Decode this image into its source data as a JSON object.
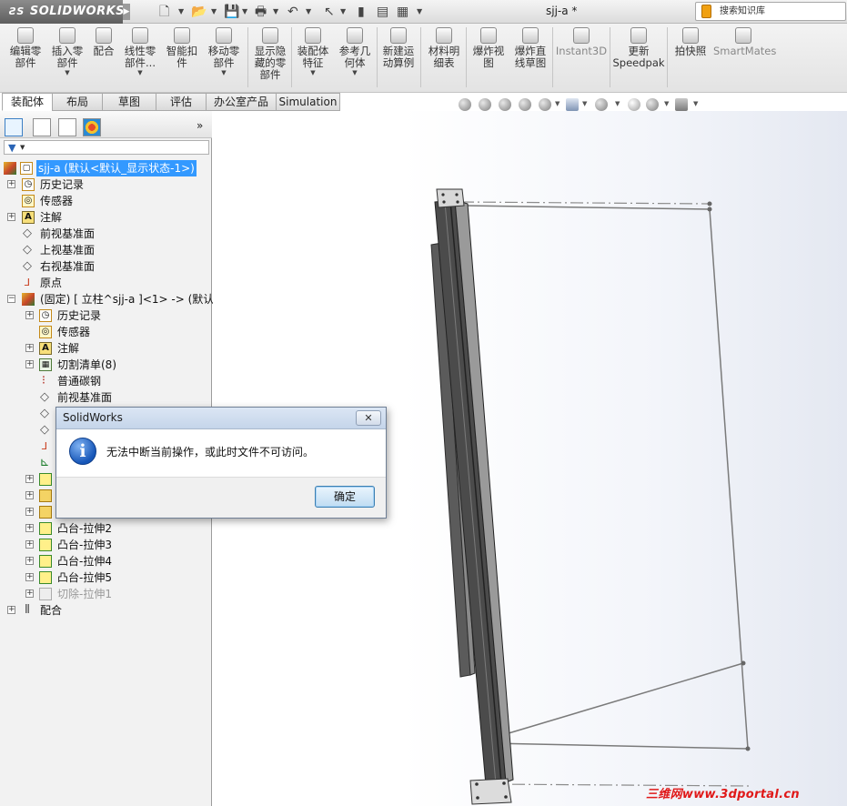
{
  "titlebar": {
    "logo": "SOLIDWORKS",
    "document_title": "sjj-a *",
    "search_placeholder": "搜索知识库"
  },
  "ribbon": {
    "items": [
      {
        "label": "编辑零\n部件"
      },
      {
        "label": "插入零\n部件"
      },
      {
        "label": "配合"
      },
      {
        "label": "线性零\n部件..."
      },
      {
        "label": "智能扣\n件"
      },
      {
        "label": "移动零\n部件"
      },
      {
        "label": "显示隐\n藏的零\n部件"
      },
      {
        "label": "装配体\n特征"
      },
      {
        "label": "参考几\n何体"
      },
      {
        "label": "新建运\n动算例"
      },
      {
        "label": "材料明\n细表"
      },
      {
        "label": "爆炸视\n图"
      },
      {
        "label": "爆炸直\n线草图"
      },
      {
        "label": "Instant3D"
      },
      {
        "label": "更新\nSpeedpak"
      },
      {
        "label": "拍快照"
      },
      {
        "label": "SmartMates"
      }
    ]
  },
  "tabs": [
    "装配体",
    "布局",
    "草图",
    "评估",
    "办公室产品",
    "Simulation"
  ],
  "active_tab": "装配体",
  "tree": {
    "rows": [
      {
        "label": "sjj-a  (默认<默认_显示状态-1>)",
        "selected": true
      },
      {
        "label": "历史记录"
      },
      {
        "label": "传感器"
      },
      {
        "label": "注解"
      },
      {
        "label": "前视基准面"
      },
      {
        "label": "上视基准面"
      },
      {
        "label": "右视基准面"
      },
      {
        "label": "原点"
      },
      {
        "label": "(固定) [ 立柱^sjj-a ]<1> -> (默认<"
      },
      {
        "label": "历史记录"
      },
      {
        "label": "传感器"
      },
      {
        "label": "注解"
      },
      {
        "label": "切割清单(8)"
      },
      {
        "label": "普通碳钢"
      },
      {
        "label": "前视基准面"
      },
      {
        "label": "凸台-拉伸2"
      },
      {
        "label": "凸台-拉伸3"
      },
      {
        "label": "凸台-拉伸4"
      },
      {
        "label": "凸台-拉伸5"
      },
      {
        "label": "切除-拉伸1"
      },
      {
        "label": "配合"
      }
    ]
  },
  "dialog": {
    "title": "SolidWorks",
    "message": "无法中断当前操作，或此时文件不可访问。",
    "ok_label": "确定",
    "close_label": "✕"
  },
  "watermark": "三维网www.3dportal.cn",
  "colors": {
    "selection": "#3399ff",
    "dialog_title": "#c5d5ea",
    "watermark": "#e01818"
  }
}
